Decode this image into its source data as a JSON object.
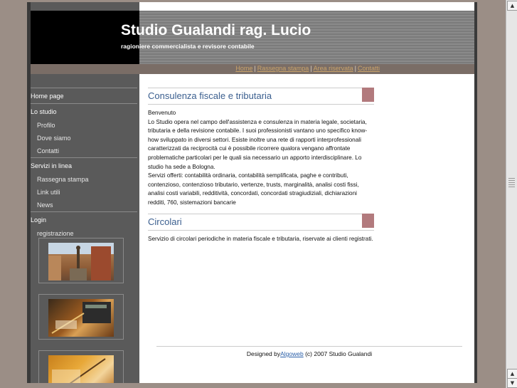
{
  "header": {
    "title": "Studio Gualandi rag. Lucio",
    "subtitle": "ragioniere commercialista e revisore contabile"
  },
  "topnav": {
    "links": [
      "Home",
      "Rassegna stampa",
      "Area riservata",
      "Contatti"
    ],
    "separator": "|"
  },
  "sidebar": {
    "home": "Home page",
    "studio": "Lo studio",
    "studio_items": [
      "Profilo",
      "Dove siamo",
      "Contatti"
    ],
    "servizi": "Servizi in linea",
    "servizi_items": [
      "Rassegna stampa",
      "Link utili",
      "News"
    ],
    "login": "Login",
    "login_items": [
      "registrazione"
    ]
  },
  "main": {
    "section1_title": "Consulenza fiscale e tributaria",
    "section1_text": "Benvenuto\n    Lo Studio opera nel campo dell'assistenza e consulenza in materia legale, societaria, tributaria e della revisione contabile. I suoi professionisti vantano uno specifico know-how sviluppato in diversi settori. Esiste inoltre una rete di rapporti interprofessionali caratterizzati da reciprocità cui è possibile ricorrere qualora vengano affrontate problematiche particolari per le quali sia necessario un apporto interdisciplinare. Lo studio ha sede a Bologna.\nServizi offerti: contabilità ordinaria, contabilità semplificata, paghe e contributi, contenzioso, contenzioso tributario, vertenze, trusts, marginalità, analisi costi fissi, analisi costi variabili, redditività, concordati, concordati stragiudiziali, dichiarazioni redditi, 760, sistemazioni bancarie",
    "section2_title": "Circolari",
    "section2_text": "Servizio di circolari periodiche in materia fiscale e tributaria, riservate ai clienti registrati."
  },
  "footer": {
    "prefix": "Designed by",
    "link": "Algoweb",
    "suffix": " (c) 2007 Studio Gualandi"
  },
  "colors": {
    "accent_box": "#b27a7d",
    "heading": "#3b5f8f",
    "sidebar": "#5a5a5a",
    "navbar": "#7a6d66",
    "background": "#9b8e86"
  }
}
